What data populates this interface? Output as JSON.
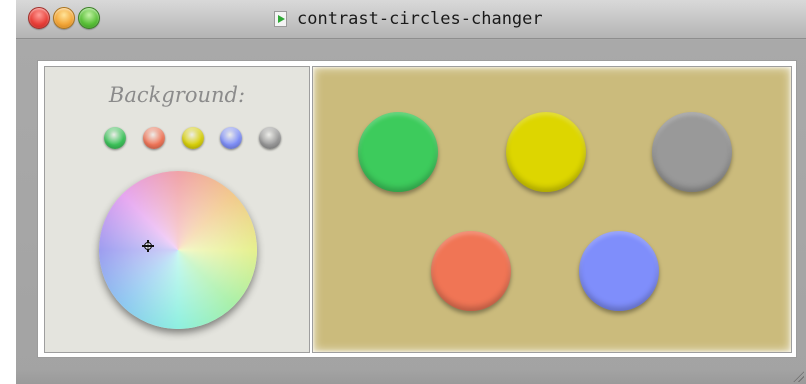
{
  "window": {
    "title": "contrast-circles-changer"
  },
  "icons": {
    "close": "close-icon",
    "minimize": "minimize-icon",
    "zoom": "zoom-icon",
    "app": "document-play-icon"
  },
  "controls": {
    "background_label": "Background:",
    "swatches": [
      {
        "name": "green",
        "color": "#3cc35a"
      },
      {
        "name": "orange",
        "color": "#f07558"
      },
      {
        "name": "yellow",
        "color": "#d9d10a"
      },
      {
        "name": "blue",
        "color": "#7f8ff8"
      },
      {
        "name": "gray",
        "color": "#999999"
      }
    ]
  },
  "canvas": {
    "background_color": "#cbbb7c",
    "circles": [
      {
        "name": "green",
        "color": "#3dcb5c"
      },
      {
        "name": "yellow",
        "color": "#ddd600"
      },
      {
        "name": "gray",
        "color": "#999999"
      },
      {
        "name": "orange",
        "color": "#f07555"
      },
      {
        "name": "blue",
        "color": "#7f8efb"
      }
    ]
  }
}
